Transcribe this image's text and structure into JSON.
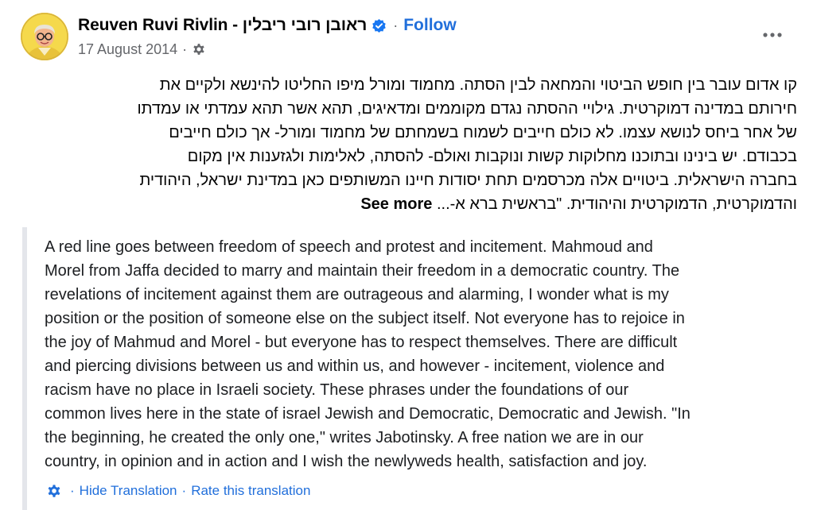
{
  "post": {
    "author": "Reuven Ruvi Rivlin - ראובן רובי ריבלין",
    "separator": "·",
    "follow_label": "Follow",
    "date": "17 August 2014",
    "date_separator": "·",
    "audience_icon": "gear-icon",
    "more_icon": "more-options-icon",
    "verified_icon": "verified-badge-icon",
    "accent_color": "#216fdb"
  },
  "hebrew_text": {
    "lines": [
      "קו אדום עובר בין חופש הביטוי והמחאה לבין הסתה. מחמוד ומורל מיפו החליטו להינשא ולקיים את",
      "חירותם במדינה דמוקרטית. גילויי ההסתה נגדם מקוממים ומדאיגים, תהא אשר תהא עמדתי או עמדתו",
      "של אחר ביחס לנושא עצמו. לא כולם חייבים לשמוח בשמחתם של מחמוד ומורל- אך כולם חייבים",
      "בכבודם. יש בינינו ובתוכנו מחלוקות קשות ונוקבות ואולם-  להסתה, לאלימות ולגזענות אין מקום",
      "בחברה הישראלית. ביטויים אלה מכרסמים תחת יסודות חיינו המשותפים כאן במדינת ישראל, היהודית"
    ],
    "last_line": "והדמוקרטית, הדמוקרטית והיהודית. \"בראשית ברא א-...",
    "see_more_label": "See more"
  },
  "translation": {
    "lines": [
      "A red line goes between freedom of speech and protest and incitement. Mahmoud and",
      "Morel from Jaffa decided to marry and maintain their freedom in a democratic country. The",
      "revelations of incitement against them are outrageous and alarming, I wonder what is my",
      "position or the position of someone else on the subject itself. Not everyone has to rejoice in",
      "the joy of Mahmud and Morel - but everyone has to respect themselves. There are difficult",
      "and piercing divisions between us and within us, and however - incitement, violence and",
      "racism have no place in Israeli society. These phrases under the foundations of our",
      "common lives here in the state of israel Jewish and Democratic, Democratic and Jewish. \"In",
      "the beginning, he created the only one,\" writes Jabotinsky. A free nation we are in our",
      "country, in opinion and in action and I wish the newlyweds health, satisfaction and joy."
    ],
    "settings_icon": "settings-gear-icon",
    "sep": "·",
    "hide_label": "Hide Translation",
    "rate_label": "Rate this translation"
  }
}
